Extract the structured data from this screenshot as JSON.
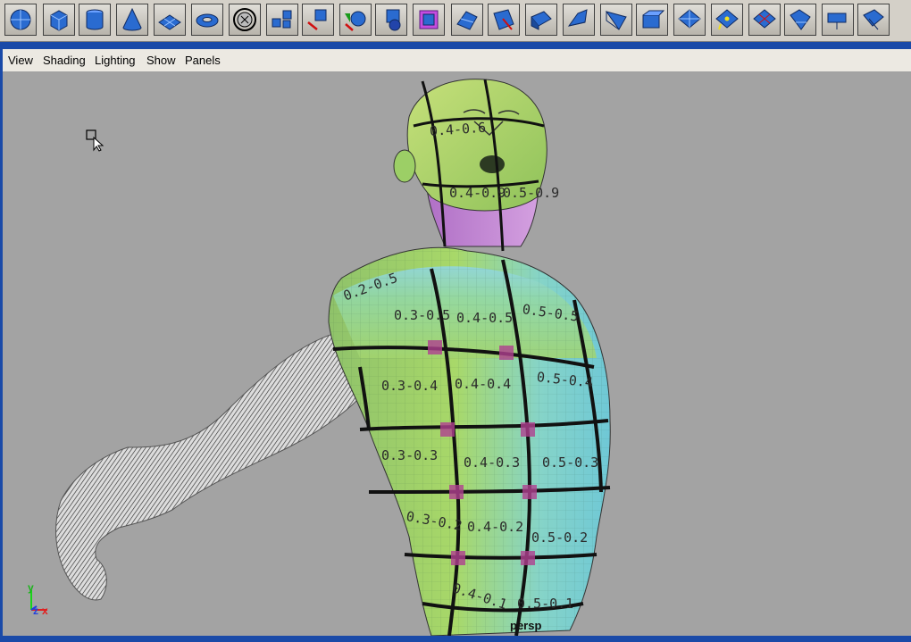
{
  "shelf": {
    "icons": [
      "polygon-sphere-icon",
      "polygon-cube-icon",
      "polygon-cylinder-icon",
      "polygon-cone-icon",
      "polygon-plane-icon",
      "polygon-torus-icon",
      "circle-select-icon",
      "combine-icon",
      "separate-icon",
      "extract-icon",
      "smooth-icon",
      "bevel-icon",
      "extrude-face-icon",
      "extrude-edge-icon",
      "bridge-icon",
      "split-polygon-icon",
      "wedge-icon",
      "duplicate-face-icon",
      "poke-icon",
      "cut-faces-icon",
      "subdivide-icon",
      "merge-icon",
      "collapse-icon",
      "triangulate-icon",
      "quadrangulate-icon",
      "soft-mod-icon",
      "checker-icon"
    ]
  },
  "menubar": {
    "view": "View",
    "shading": "Shading",
    "lighting": "Lighting",
    "show": "Show",
    "panels": "Panels"
  },
  "viewport": {
    "camera": "persp",
    "uv_labels": [
      "0.4-0.6",
      "0.4-0.9",
      "0.5-0.9",
      "0.2-0.5",
      "0.3-0.5",
      "0.4-0.5",
      "0.5-0.5",
      "0.3-0.4",
      "0.4-0.4",
      "0.5-0.4",
      "0.3-0.3",
      "0.4-0.3",
      "0.5-0.3",
      "0.3-0.2",
      "0.4-0.2",
      "0.5-0.2",
      "0.4-0.1",
      "0.5-0.1"
    ],
    "axis": {
      "y": "y",
      "z": "z",
      "x": "x"
    }
  },
  "colors": {
    "frame_blue": "#1a4aa8",
    "viewport_bg": "#a3a3a3",
    "mesh_green": "#a8d060",
    "mesh_cyan": "#7ed2d8",
    "mesh_purple": "#c48ad4",
    "icon_blue": "#2a6bd0"
  }
}
